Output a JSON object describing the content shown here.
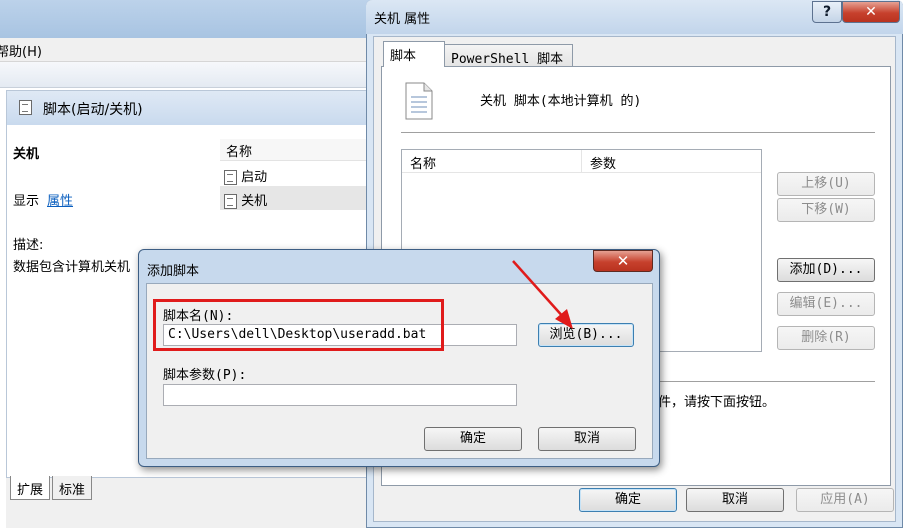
{
  "gpedit": {
    "menu_help": "帮助(H)",
    "header_title": "脚本(启动/关机)",
    "section_title": "关机",
    "display_label": "显示",
    "properties_link": "属性",
    "description_label": "描述:",
    "description_text": "数据包含计算机关机",
    "column_name": "名称",
    "items": [
      {
        "label": "启动"
      },
      {
        "label": "关机"
      }
    ],
    "tabs": [
      "扩展",
      "标准"
    ]
  },
  "props": {
    "title": "关机 属性",
    "help_glyph": "?",
    "close_glyph": "✕",
    "tabs": [
      "脚本",
      "PowerShell 脚本"
    ],
    "heading": "关机 脚本(本地计算机 的)",
    "list_columns": [
      "名称",
      "参数"
    ],
    "buttons": {
      "up": "上移(U)",
      "down": "下移(W)",
      "add": "添加(D)...",
      "edit": "编辑(E)...",
      "remove": "删除(R)"
    },
    "hint_text": "件，请按下面按钮。",
    "ok": "确定",
    "cancel": "取消",
    "apply": "应用(A)"
  },
  "add_script": {
    "title": "添加脚本",
    "close_glyph": "✕",
    "name_label": "脚本名(N):",
    "name_value": "C:\\Users\\dell\\Desktop\\useradd.bat",
    "browse": "浏览(B)...",
    "params_label": "脚本参数(P):",
    "params_value": "",
    "ok": "确定",
    "cancel": "取消"
  },
  "colors": {
    "annotation_red": "#e01b1b",
    "link_blue": "#0b5fbf"
  }
}
